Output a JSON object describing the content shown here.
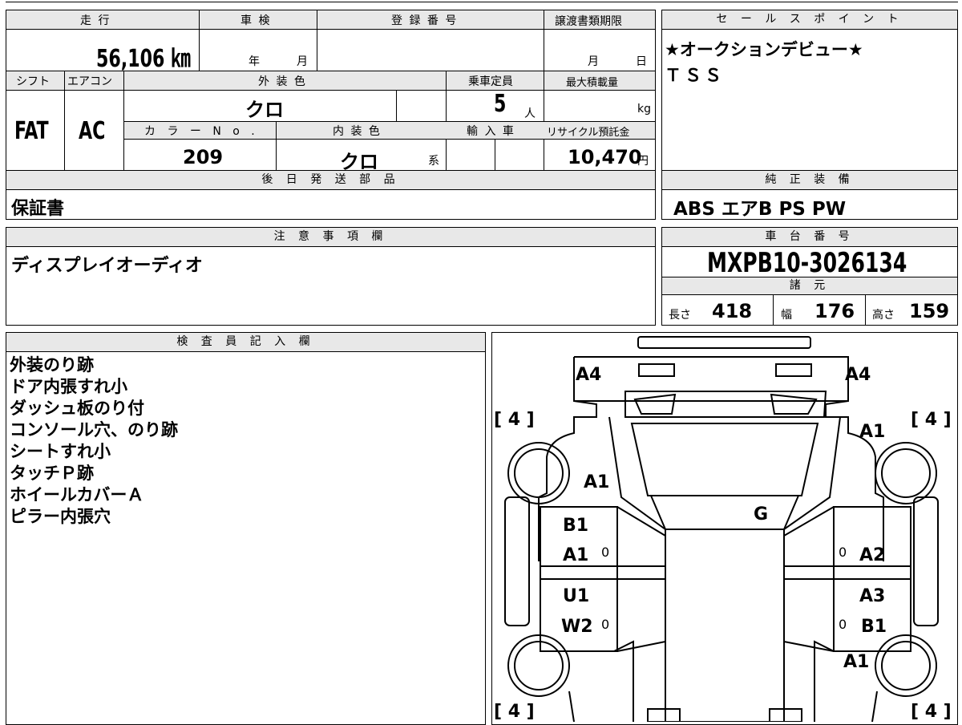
{
  "top_headers": {
    "mileage": "走 行",
    "inspection": "車 検",
    "registration": "登 録 番 号",
    "transfer_deadline": "譲渡書類期限",
    "selling_points": "セ ー ル ス ポ イ ン ト",
    "shift": "シフト",
    "aircon": "エアコン",
    "exterior_color": "外 装 色",
    "capacity": "乗車定員",
    "max_load": "最大積載量",
    "color_no": "カ ラ ー N o .",
    "interior_color": "内 装 色",
    "import": "輸 入 車",
    "recycle": "リサイクル預託金",
    "later_parts": "後 日 発 送 部 品",
    "genuine_equipment": "純 正 装 備",
    "notes": "注 意 事 項 欄",
    "chassis_no": "車 台 番 号",
    "specs": "諸 元",
    "inspector": "検 査 員 記 入 欄"
  },
  "values": {
    "mileage": "56,106 ㎞",
    "inspection_year_unit": "年",
    "inspection_month_unit": "月",
    "deadline_month_unit": "月",
    "deadline_day_unit": "日",
    "shift": "FAT",
    "aircon": "AC",
    "exterior_color": "クロ",
    "capacity": "5",
    "capacity_unit": "人",
    "max_load_unit": "kg",
    "color_no": "209",
    "interior_color": "クロ",
    "interior_suffix": "系",
    "recycle": "10,470",
    "recycle_unit": "円",
    "later_parts": "保証書",
    "selling_line1": "★オークションデビュー★",
    "selling_line2": "ＴＳＳ",
    "genuine_equipment": "ABS エアB PS PW",
    "notes": "ディスプレイオーディオ",
    "chassis_no": "MXPB10-3026134",
    "length_label": "長さ",
    "length": "418",
    "width_label": "幅",
    "width": "176",
    "height_label": "高さ",
    "height": "159"
  },
  "inspector_notes": [
    "外装のり跡",
    "ドア内張すれ小",
    "ダッシュ板のり付",
    "コンソール穴、のり跡",
    "シートすれ小",
    "タッチＰ跡",
    "ホイールカバーＡ",
    "ピラー内張穴"
  ],
  "diagram": {
    "front_left": "A4",
    "front_right": "A4",
    "tire_fl": "[ 4 ]",
    "tire_fr": "[ 4 ]",
    "tire_rl": "[ 4 ]",
    "tire_rr": "[ 4 ]",
    "fender_fl": "A1",
    "fender_fr": "A1",
    "roof": "G",
    "door_fl_1": "B1",
    "door_fl_2": "A1",
    "door_fr": "A2",
    "door_rl_1": "U1",
    "door_rl_2": "W2",
    "door_rr_1": "A3",
    "door_rr_2": "B1",
    "rear_right": "A1",
    "zero": "0"
  }
}
